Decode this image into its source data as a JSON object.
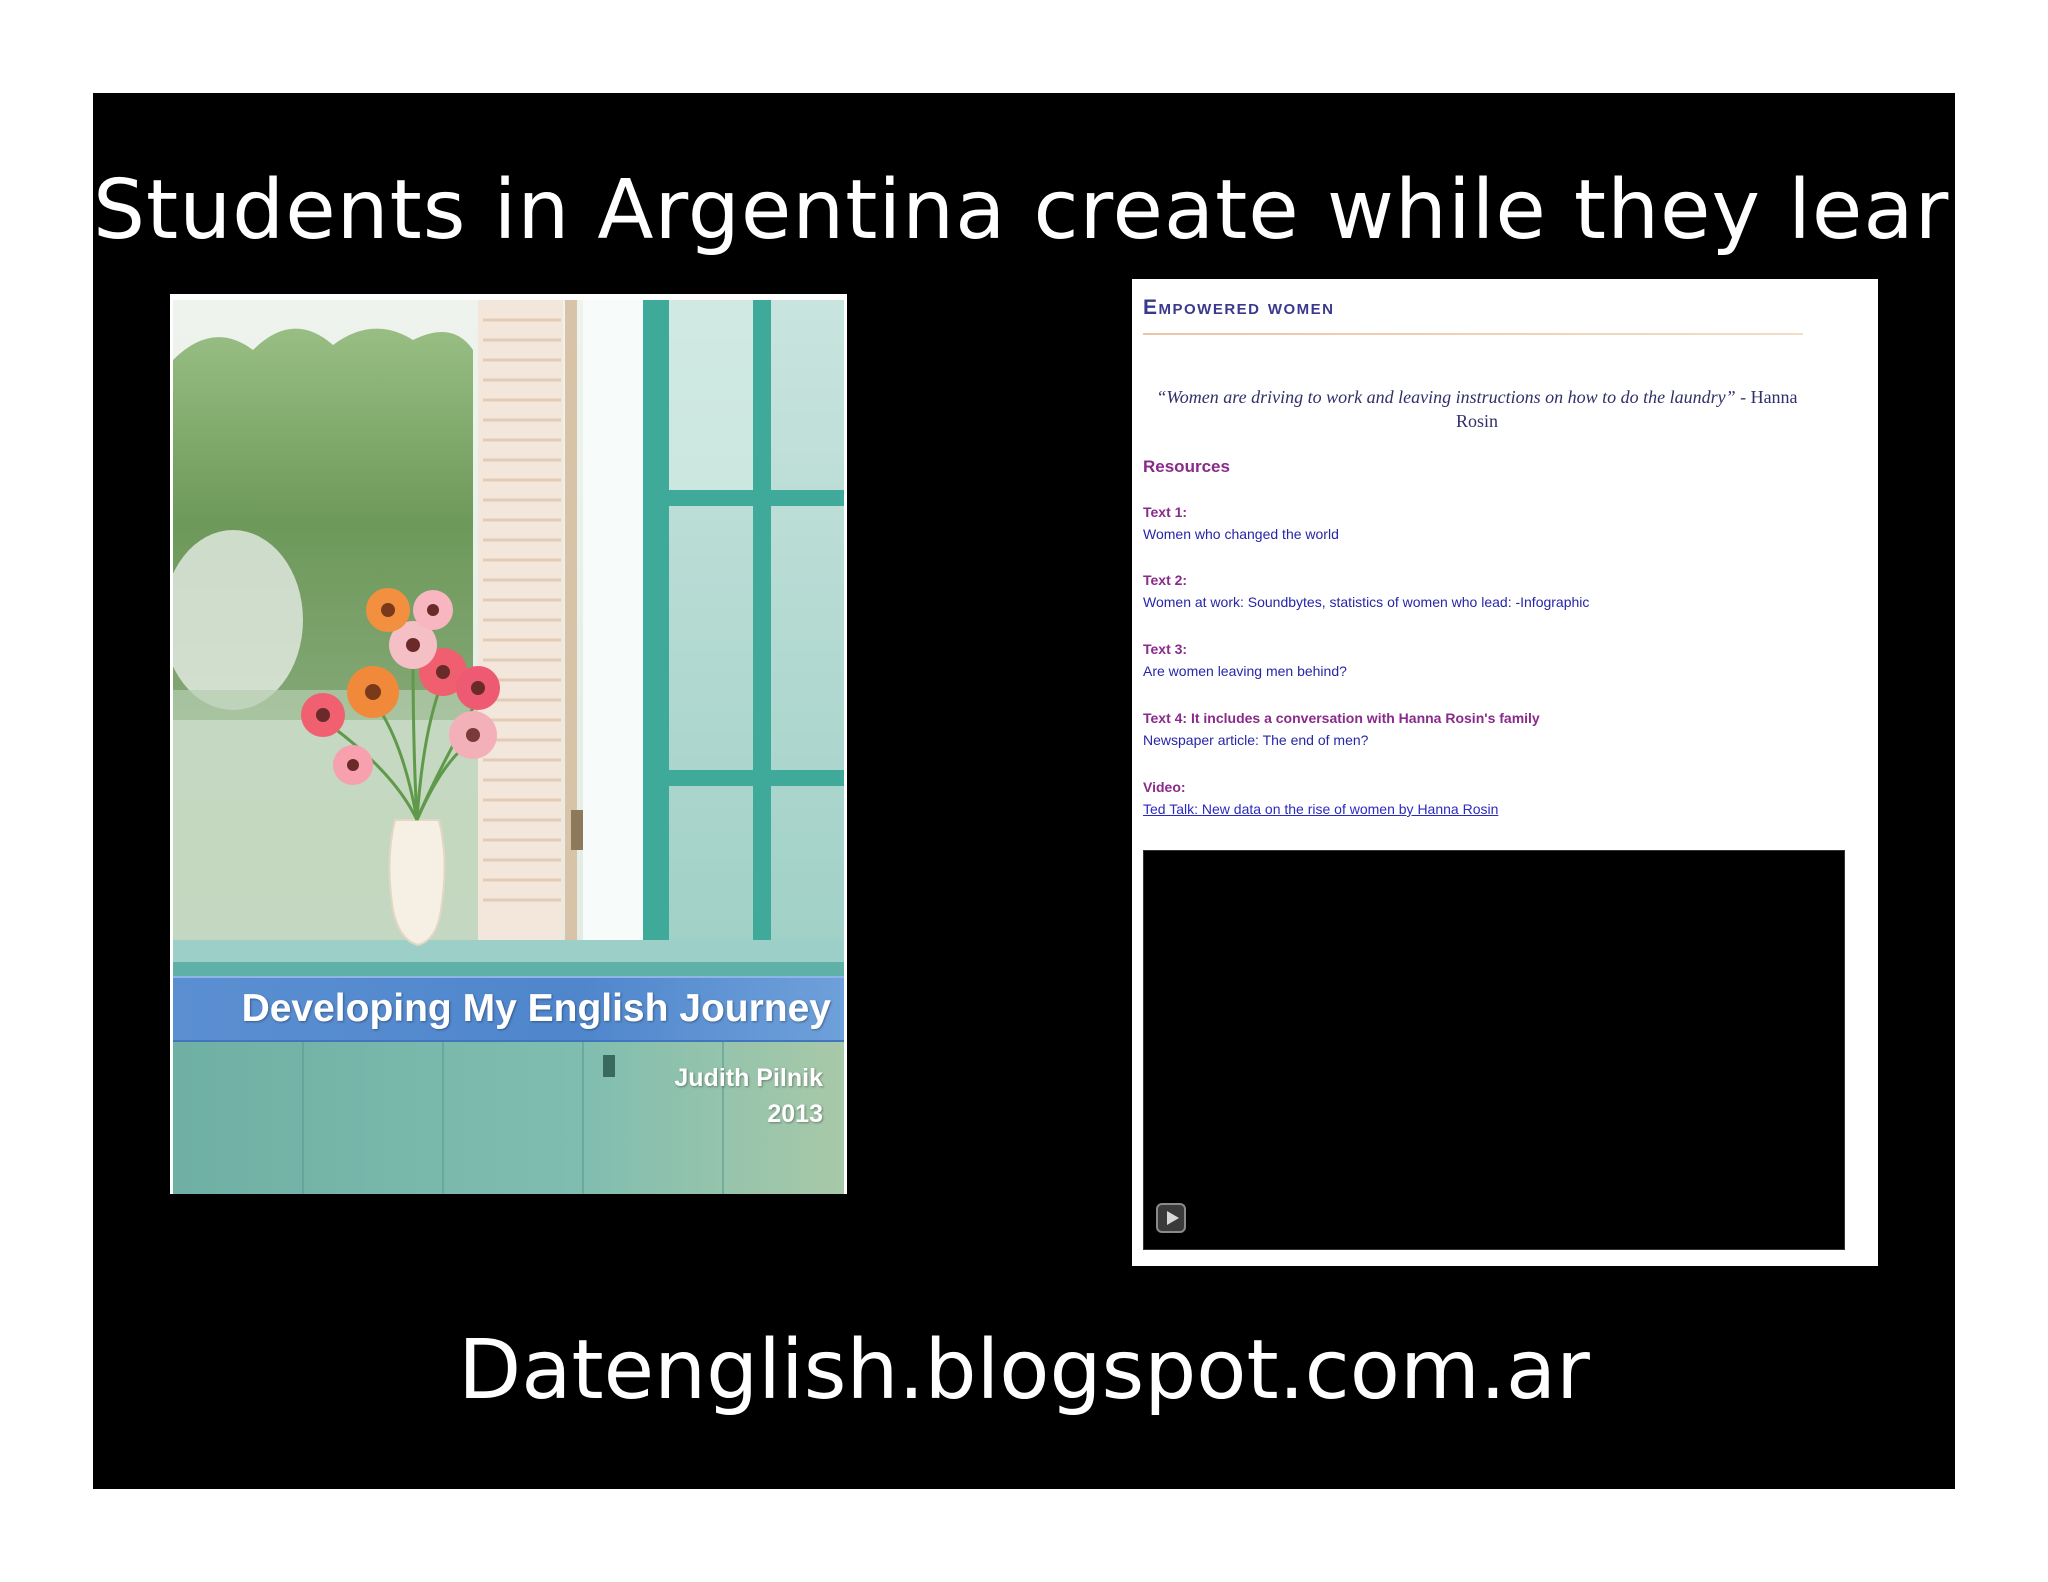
{
  "slide": {
    "title": "Students in Argentina create while they learn",
    "footer": "Datenglish.blogspot.com.ar"
  },
  "cover": {
    "title": "Developing My English Journey",
    "author": "Judith Pilnik",
    "year": "2013"
  },
  "webpage": {
    "heading": "Empowered women",
    "quote_italic": "“Women are driving to work and leaving instructions on how to do the laundry”",
    "quote_attribution": " - Hanna Rosin",
    "resources_label": "Resources",
    "items": [
      {
        "label": "Text 1:",
        "text": "Women who changed the world"
      },
      {
        "label": "Text 2:",
        "text": "Women at work: Soundbytes, statistics of women who lead: -Infographic"
      },
      {
        "label": "Text 3:",
        "text": "Are women leaving men behind?"
      },
      {
        "label": "Text 4: It includes a conversation with Hanna Rosin's family",
        "text": "Newspaper article: The end of men?"
      },
      {
        "label": "Video:",
        "text": "Ted Talk: New data on the rise of women by Hanna Rosin"
      }
    ],
    "play_icon": "play-icon"
  }
}
